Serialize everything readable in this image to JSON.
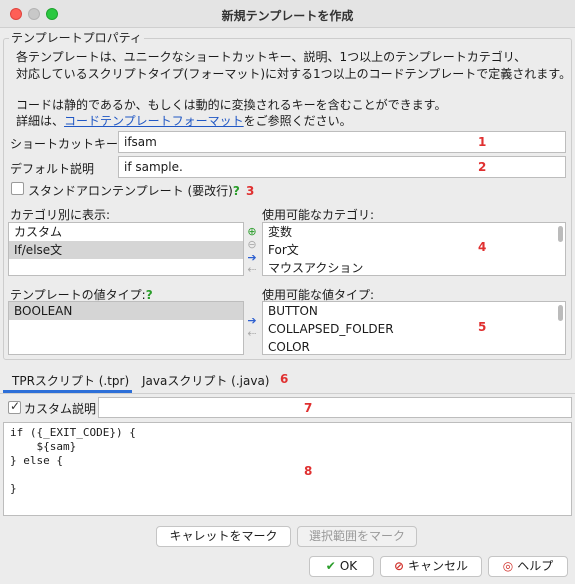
{
  "window": {
    "title": "新規テンプレートを作成"
  },
  "group": {
    "title": "テンプレートプロパティ"
  },
  "description": {
    "line1": "各テンプレートは、ユニークなショートカットキー、説明、1つ以上のテンプレートカテゴリ、",
    "line2": "対応しているスクリプトタイプ(フォーマット)に対する1つ以上のコードテンプレートで定義されます。",
    "line3": "コードは静的であるか、もしくは動的に変換されるキーを含むことができます。",
    "line4_prefix": "詳細は、",
    "line4_link": "コードテンプレートフォーマット",
    "line4_suffix": "をご参照ください。"
  },
  "form": {
    "shortcut_label": "ショートカットキー",
    "shortcut_value": "ifsam",
    "default_desc_label": "デフォルト説明",
    "default_desc_value": "if sample.",
    "standalone_label": "スタンドアロンテンプレート (要改行)",
    "help_mark": "?"
  },
  "categories": {
    "shown_label": "カテゴリ別に表示:",
    "shown_items": [
      "カスタム",
      "If/else文"
    ],
    "available_label": "使用可能なカテゴリ:",
    "available_items": [
      "変数",
      "For文",
      "マウスアクション"
    ]
  },
  "value_types": {
    "template_label": "テンプレートの値タイプ:",
    "template_items": [
      "BOOLEAN"
    ],
    "available_label": "使用可能な値タイプ:",
    "available_items": [
      "BUTTON",
      "COLLAPSED_FOLDER",
      "COLOR"
    ]
  },
  "tabs": [
    {
      "label": "TPRスクリプト (.tpr)",
      "active": true
    },
    {
      "label": "Javaスクリプト (.java)",
      "active": false
    }
  ],
  "custom_desc": {
    "label": "カスタム説明",
    "value": "",
    "checked": true
  },
  "code_lines": [
    "if ({_EXIT_CODE}) {",
    "    ${sam}",
    "} else {",
    "",
    "}"
  ],
  "buttons": {
    "mark_caret": "キャレットをマーク",
    "mark_selection": "選択範囲をマーク",
    "ok": "OK",
    "cancel": "キャンセル",
    "help": "ヘルプ"
  },
  "annotations": [
    "1",
    "2",
    "3",
    "4",
    "5",
    "6",
    "7",
    "8"
  ],
  "colors": {
    "accent": "#2d6fd8",
    "annotation": "#e03030",
    "ok_icon": "#2a9d2a",
    "cancel_icon": "#d0302a"
  }
}
